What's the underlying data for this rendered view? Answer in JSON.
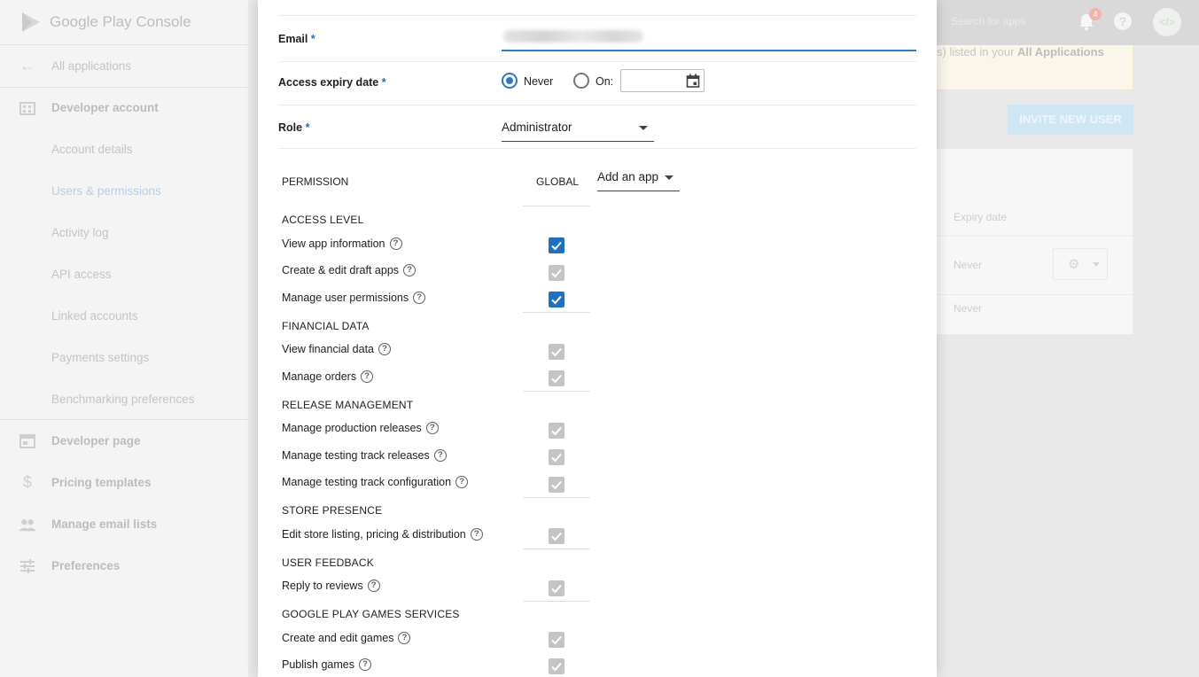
{
  "background": {
    "brand": "Google Play Console",
    "sidebar": {
      "items": [
        {
          "label": "All applications",
          "icon": "arrow-back-icon"
        },
        {
          "label": "Developer account",
          "icon": "building-icon"
        },
        {
          "label": "Account details"
        },
        {
          "label": "Users & permissions"
        },
        {
          "label": "Activity log"
        },
        {
          "label": "API access"
        },
        {
          "label": "Linked accounts"
        },
        {
          "label": "Payments settings"
        },
        {
          "label": "Benchmarking preferences"
        },
        {
          "label": "Developer page",
          "icon": "web-page-icon"
        },
        {
          "label": "Pricing templates",
          "icon": "dollar-icon"
        },
        {
          "label": "Manage email lists",
          "icon": "people-icon"
        },
        {
          "label": "Preferences",
          "icon": "sliders-icon"
        }
      ]
    },
    "topbar": {
      "search_placeholder": "Search for apps",
      "notification_count": "4",
      "help": "?",
      "avatar_text": "</>"
    },
    "notice": {
      "text_prefix": "s) listed in your ",
      "text_bold": "All Applications"
    },
    "invite_button": "INVITE NEW USER",
    "users_table": {
      "column_header": "Expiry date",
      "rows": [
        "Never",
        "Never"
      ]
    }
  },
  "dialog": {
    "email": {
      "label": "Email",
      "required": "*",
      "value": ""
    },
    "access_expiry": {
      "label": "Access expiry date",
      "required": "*",
      "options": {
        "never": "Never",
        "on": "On:"
      },
      "selected": "never",
      "date_value": ""
    },
    "role": {
      "label": "Role",
      "required": "*",
      "value": "Administrator"
    },
    "permissions": {
      "header_permission": "PERMISSION",
      "header_global": "GLOBAL",
      "add_app": "Add an app",
      "sections": [
        {
          "title": "ACCESS LEVEL",
          "items": [
            {
              "label": "View app information",
              "checked": true,
              "enabled": true
            },
            {
              "label": "Create & edit draft apps",
              "checked": true,
              "enabled": false
            },
            {
              "label": "Manage user permissions",
              "checked": true,
              "enabled": true
            }
          ]
        },
        {
          "title": "FINANCIAL DATA",
          "items": [
            {
              "label": "View financial data",
              "checked": true,
              "enabled": false
            },
            {
              "label": "Manage orders",
              "checked": true,
              "enabled": false
            }
          ]
        },
        {
          "title": "RELEASE MANAGEMENT",
          "items": [
            {
              "label": "Manage production releases",
              "checked": true,
              "enabled": false
            },
            {
              "label": "Manage testing track releases",
              "checked": true,
              "enabled": false
            },
            {
              "label": "Manage testing track configuration",
              "checked": true,
              "enabled": false
            }
          ]
        },
        {
          "title": "STORE PRESENCE",
          "items": [
            {
              "label": "Edit store listing, pricing & distribution",
              "checked": true,
              "enabled": false
            }
          ]
        },
        {
          "title": "USER FEEDBACK",
          "items": [
            {
              "label": "Reply to reviews",
              "checked": true,
              "enabled": false
            }
          ]
        },
        {
          "title": "GOOGLE PLAY GAMES SERVICES",
          "items": [
            {
              "label": "Create and edit games",
              "checked": true,
              "enabled": false
            },
            {
              "label": "Publish games",
              "checked": true,
              "enabled": false
            }
          ]
        }
      ]
    }
  },
  "colors": {
    "accent": "#1f70c1",
    "disabled_checkbox": "#c4c4c4"
  }
}
